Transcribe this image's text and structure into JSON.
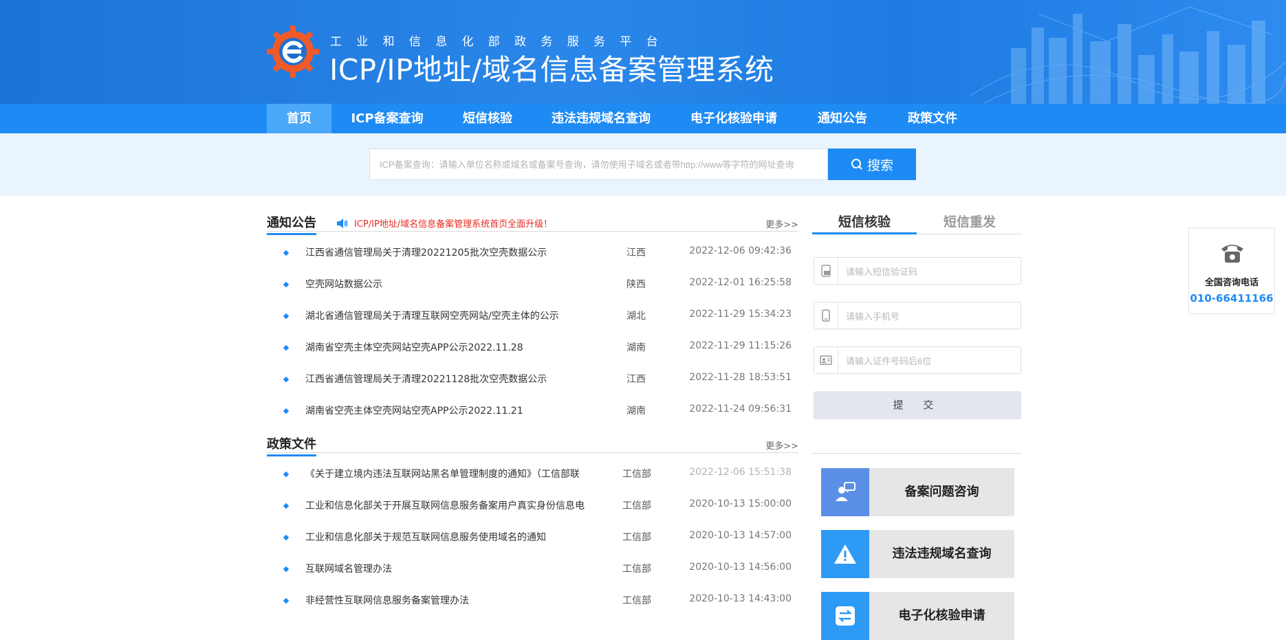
{
  "header": {
    "slogan": "工业和信息化部政务服务平台",
    "title": "ICP/IP地址/域名信息备案管理系统"
  },
  "nav": {
    "items": [
      {
        "label": "首页",
        "active": true
      },
      {
        "label": "ICP备案查询"
      },
      {
        "label": "短信核验"
      },
      {
        "label": "违法违规域名查询"
      },
      {
        "label": "电子化核验申请"
      },
      {
        "label": "通知公告"
      },
      {
        "label": "政策文件"
      }
    ]
  },
  "search": {
    "placeholder": "ICP备案查询：请输入单位名称或域名或备案号查询，请勿使用子域名或者带http://www等字符的网址查询",
    "button_label": "搜索"
  },
  "notices": {
    "title": "通知公告",
    "marquee": "ICP/IP地址/域名信息备案管理系统首页全面升级！",
    "more": "更多>>",
    "items": [
      {
        "title": "江西省通信管理局关于清理20221205批次空壳数据公示",
        "region": "江西",
        "time": "2022-12-06 09:42:36"
      },
      {
        "title": "空壳网站数据公示",
        "region": "陕西",
        "time": "2022-12-01 16:25:58"
      },
      {
        "title": "湖北省通信管理局关于清理互联网空壳网站/空壳主体的公示",
        "region": "湖北",
        "time": "2022-11-29 15:34:23"
      },
      {
        "title": "湖南省空壳主体空壳网站空壳APP公示2022.11.28",
        "region": "湖南",
        "time": "2022-11-29 11:15:26"
      },
      {
        "title": "江西省通信管理局关于清理20221128批次空壳数据公示",
        "region": "江西",
        "time": "2022-11-28 18:53:51"
      },
      {
        "title": "湖南省空壳主体空壳网站空壳APP公示2022.11.21",
        "region": "湖南",
        "time": "2022-11-24 09:56:31"
      }
    ]
  },
  "policies": {
    "title": "政策文件",
    "more": "更多>>",
    "items": [
      {
        "title": "《关于建立境内违法互联网站黑名单管理制度的通知》（工信部联",
        "region": "工信部",
        "time": "2022-12-06 15:51:38"
      },
      {
        "title": "工业和信息化部关于开展互联网信息服务备案用户真实身份信息电",
        "region": "工信部",
        "time": "2020-10-13 15:00:00"
      },
      {
        "title": "工业和信息化部关于规范互联网信息服务使用域名的通知",
        "region": "工信部",
        "time": "2020-10-13 14:57:00"
      },
      {
        "title": "互联网域名管理办法",
        "region": "工信部",
        "time": "2020-10-13 14:56:00"
      },
      {
        "title": "非经营性互联网信息服务备案管理办法",
        "region": "工信部",
        "time": "2020-10-13 14:43:00"
      }
    ]
  },
  "sms": {
    "tabs": [
      "短信核验",
      "短信重发"
    ],
    "code_placeholder": "请输入短信验证码",
    "phone_placeholder": "请输入手机号",
    "id_placeholder": "请输入证件号码后6位",
    "submit_label": "提 交"
  },
  "services": [
    {
      "label": "备案问题咨询",
      "icon": "consult-icon",
      "color": "#5b8fe6"
    },
    {
      "label": "违法违规域名查询",
      "icon": "warning-icon",
      "color": "#2d9af5"
    },
    {
      "label": "电子化核验申请",
      "icon": "exchange-icon",
      "color": "#2d9af5"
    }
  ],
  "contact": {
    "label": "全国咨询电话",
    "number": "010-66411166"
  },
  "colors": {
    "brand": "#1e8bf4",
    "alert": "#e8281e"
  }
}
